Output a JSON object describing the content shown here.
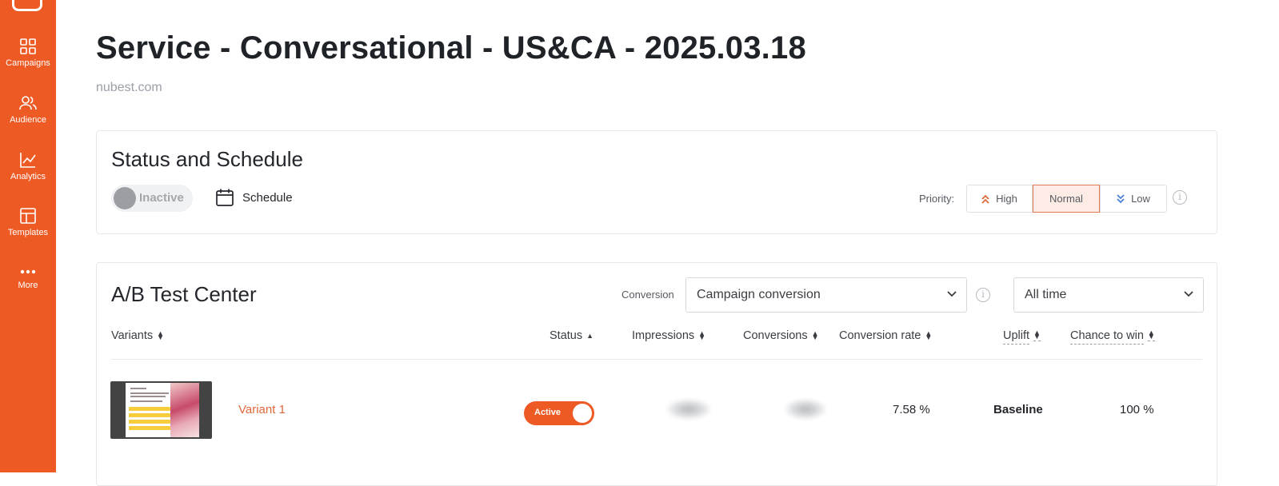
{
  "sidebar": {
    "items": [
      {
        "label": "Campaigns",
        "icon": "grid-icon"
      },
      {
        "label": "Audience",
        "icon": "users-icon"
      },
      {
        "label": "Analytics",
        "icon": "chart-line-icon"
      },
      {
        "label": "Templates",
        "icon": "layout-icon"
      },
      {
        "label": "More",
        "icon": "more-dots-icon"
      }
    ]
  },
  "header": {
    "title": "Service - Conversational - US&CA - 2025.03.18",
    "domain": "nubest.com"
  },
  "status_card": {
    "title": "Status and Schedule",
    "toggle_label": "Inactive",
    "schedule_label": "Schedule",
    "priority_label": "Priority:",
    "priority_options": [
      "High",
      "Normal",
      "Low"
    ],
    "priority_selected": "Normal"
  },
  "ab_card": {
    "title": "A/B Test Center",
    "conversion_label": "Conversion",
    "conversion_select": "Campaign conversion",
    "period_select": "All time",
    "columns": {
      "variants": "Variants",
      "status": "Status",
      "impressions": "Impressions",
      "conversions": "Conversions",
      "conversion_rate": "Conversion rate",
      "uplift": "Uplift",
      "chance_to_win": "Chance to win"
    },
    "rows": [
      {
        "name": "Variant 1",
        "status": "Active",
        "conversion_rate": "7.58 %",
        "uplift": "Baseline",
        "chance_to_win": "100 %"
      }
    ]
  },
  "colors": {
    "accent": "#ee5a24",
    "sidebar": "#ee5a24"
  }
}
